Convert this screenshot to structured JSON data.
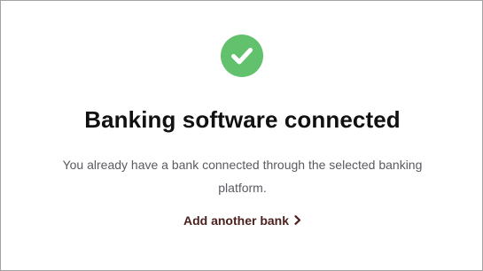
{
  "status": {
    "icon": "check-circle-icon",
    "color": "#62c16c"
  },
  "title": "Banking software connected",
  "description": "You already have a bank connected through the selected banking platform.",
  "action": {
    "label": "Add another bank",
    "icon": "chevron-right-icon",
    "color": "#4a1f1d"
  }
}
